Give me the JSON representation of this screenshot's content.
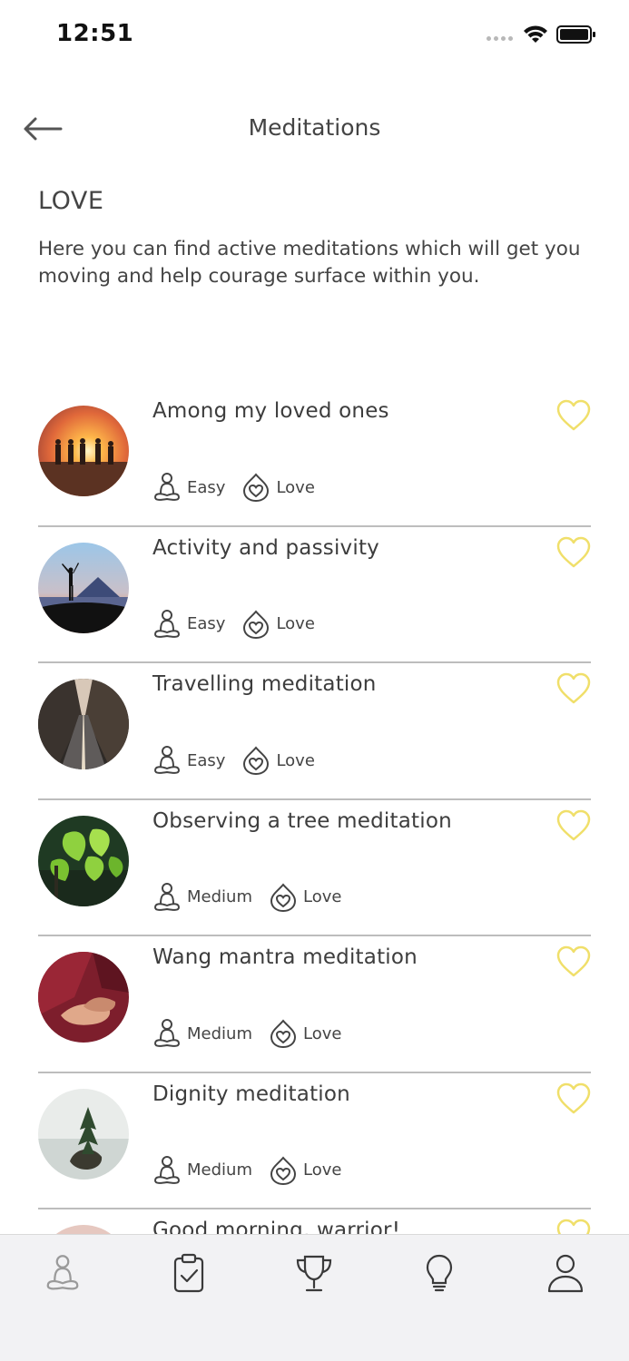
{
  "status_bar": {
    "time": "12:51"
  },
  "header": {
    "title": "Meditations"
  },
  "category": {
    "title": "LOVE",
    "description": "Here you can find active meditations which will get you moving and help courage surface within you."
  },
  "meditations": [
    {
      "title": "Among my loved ones",
      "difficulty": "Easy",
      "category": "Love",
      "image": "sunset-people"
    },
    {
      "title": "Activity and passivity",
      "difficulty": "Easy",
      "category": "Love",
      "image": "mountain-silhouette"
    },
    {
      "title": "Travelling meditation",
      "difficulty": "Easy",
      "category": "Love",
      "image": "forest-road"
    },
    {
      "title": "Observing a tree meditation",
      "difficulty": "Medium",
      "category": "Love",
      "image": "green-leaves"
    },
    {
      "title": "Wang mantra meditation",
      "difficulty": "Medium",
      "category": "Love",
      "image": "monk-hands"
    },
    {
      "title": "Dignity meditation",
      "difficulty": "Medium",
      "category": "Love",
      "image": "tree-on-rock"
    },
    {
      "title": "Good morning, warrior!",
      "difficulty": "",
      "category": "",
      "image": "partial"
    }
  ],
  "tab_bar": {
    "tabs": [
      {
        "icon": "meditation-icon"
      },
      {
        "icon": "clipboard-check-icon"
      },
      {
        "icon": "trophy-icon"
      },
      {
        "icon": "lightbulb-icon"
      },
      {
        "icon": "profile-icon"
      }
    ]
  },
  "colors": {
    "heart": "#f3e27a",
    "text": "#3d3d3d",
    "divider": "#bdbdbd",
    "tab_bar": "#f2f2f4"
  }
}
